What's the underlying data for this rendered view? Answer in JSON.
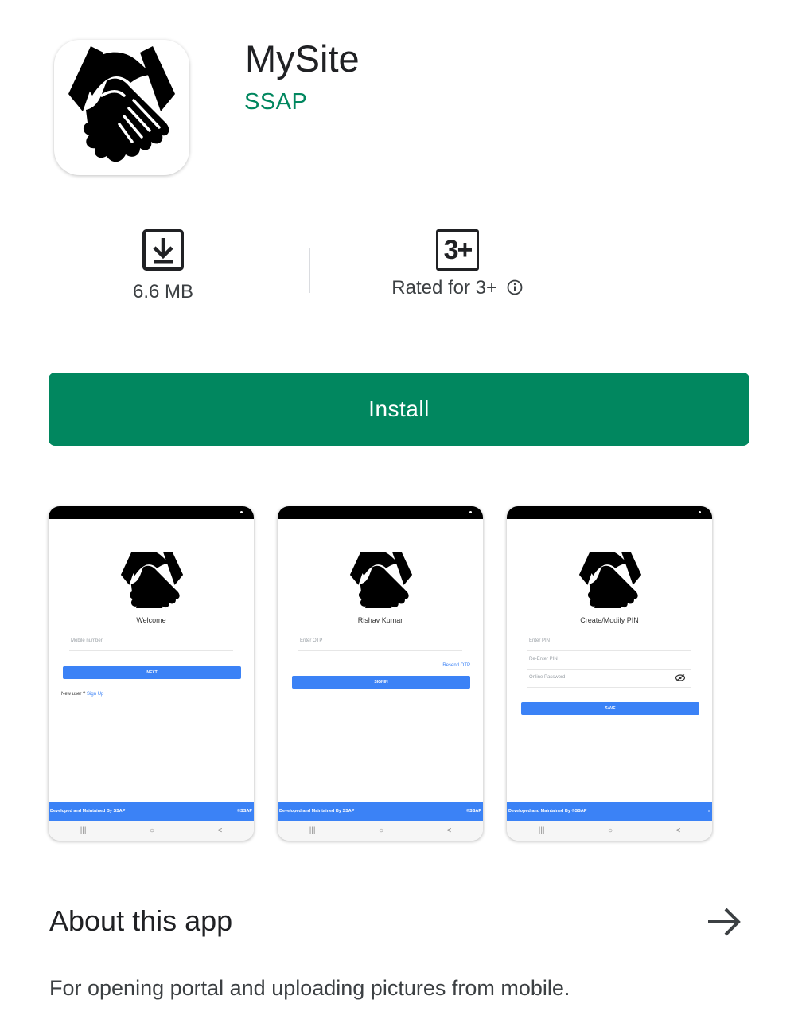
{
  "app": {
    "title": "MySite",
    "developer": "SSAP",
    "icon": "handshake-icon"
  },
  "stats": {
    "size": "6.6 MB",
    "size_icon": "download-icon",
    "rating_badge": "3+",
    "rating_label": "Rated for 3+",
    "rating_info_icon": "info-icon"
  },
  "install_button": {
    "label": "Install"
  },
  "colors": {
    "accent": "#01875f",
    "screenshot_blue": "#3b82f6"
  },
  "screenshots": [
    {
      "heading": "Welcome",
      "field1": "Mobile number",
      "button": "NEXT",
      "newuser": "New user ?",
      "signup": "Sign Up",
      "footer_left": "Developed and Maintained By SSAP",
      "footer_right": "©SSAP"
    },
    {
      "heading": "Rishav Kumar",
      "field1": "Enter OTP",
      "resend": "Resend OTP",
      "button": "SIGNIN",
      "footer_left": "Developed and Maintained By SSAP",
      "footer_right": "©SSAP"
    },
    {
      "heading": "Create/Modify PIN",
      "field1": "Enter PIN",
      "field2": "Re-Enter PIN",
      "field3": "Online Password",
      "button": "SAVE",
      "footer_left": "Developed and Maintained By ©SSAP",
      "footer_right": "≡"
    }
  ],
  "nav_glyphs": [
    "|||",
    "○",
    "<"
  ],
  "about": {
    "title": "About this app",
    "arrow_icon": "arrow-right-icon",
    "description": "For opening portal and uploading pictures from mobile."
  }
}
